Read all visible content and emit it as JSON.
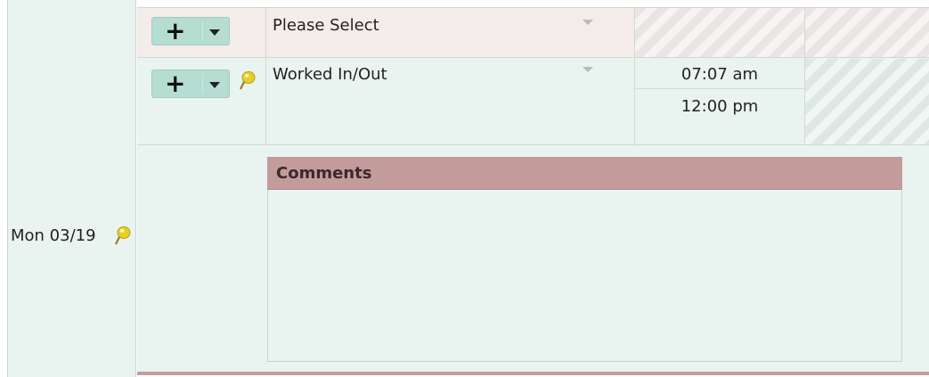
{
  "day": {
    "label": "Mon 03/19"
  },
  "rows": [
    {
      "select_value": "Please Select"
    },
    {
      "select_value": "Worked In/Out",
      "time_in": "07:07 am",
      "time_out": "12:00 pm"
    }
  ],
  "comments": {
    "header": "Comments",
    "value": ""
  },
  "icons": {
    "add": "plus-icon",
    "menu": "chevron-down-icon",
    "note": "pushpin-note-icon"
  },
  "colors": {
    "row_bg": "#e9f3f0",
    "row1_bg": "#f4ecea",
    "button_bg": "#b6ddd2",
    "comments_header_bg": "#c49b9b",
    "note_pin": "#e6cf2a"
  }
}
